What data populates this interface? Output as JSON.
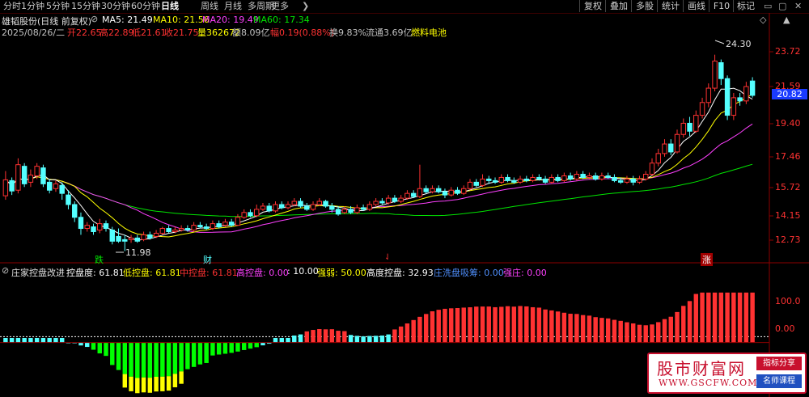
{
  "toolbar": {
    "periods": [
      "分时",
      "1分钟",
      "5分钟",
      "15分钟",
      "30分钟",
      "60分钟",
      "日线",
      "周线",
      "月线",
      "多周期",
      "更多"
    ],
    "active_period": "日线",
    "buttons": [
      "复权",
      "叠加",
      "多股",
      "统计",
      "画线",
      "F10",
      "标记"
    ],
    "more_arrow": "❯"
  },
  "header": {
    "stock_name": "雄韬股份(日线 前复权)",
    "ma5": "MA5: 21.49",
    "ma10": "MA10: 21.56",
    "ma20": "MA20: 19.49",
    "ma60": "MA60: 17.34",
    "date": "2025/08/26/二",
    "open": "开22.65",
    "high": "高22.89",
    "low": "低21.61",
    "close": "收21.75",
    "volume": "量362672",
    "amount": "额8.09亿",
    "change": "幅0.19(0.88%)",
    "turnover": "换9.83%",
    "float_cap": "流通3.69亿",
    "sector": "燃料电池"
  },
  "price_axis": {
    "ticks": [
      "23.72",
      "21.59",
      "19.40",
      "17.46",
      "15.72",
      "14.15",
      "12.73"
    ],
    "current": "20.82"
  },
  "price_annotations": {
    "high_label": "24.30",
    "low_label": "11.98",
    "die_marker": "跌",
    "cai_marker": "财",
    "zhang_marker": "涨"
  },
  "indicator": {
    "name": "庄家控盘改进",
    "kongpandu": "控盘度: 61.81",
    "dikongpan": "低控盘: 61.81",
    "zhongkongpan": "中控盘: 61.81",
    "gaokongpan": "高控盘: 0.00",
    "ten": ": 10.00",
    "qiangruo": "强弱: 50.00",
    "gaodukongpan": "高度控盘: 32.93",
    "xichou": "庄洗盘吸筹: 0.00",
    "qiangzhuang": "强庄: 0.00",
    "axis_ticks": [
      "100.0",
      "0.00"
    ]
  },
  "watermark": {
    "title": "股市财富网",
    "url": "WWW.GSCFW.COM",
    "tag1": "指标分享",
    "tag2": "名师课程"
  },
  "colors": {
    "up": "#ff3232",
    "down": "#54ffff",
    "ma5": "#ffffff",
    "ma10": "#ffff00",
    "ma20": "#ff40ff",
    "ma60": "#00e600"
  },
  "chart_data": {
    "type": "candlestick",
    "price_ylim": [
      11.5,
      25.5
    ],
    "candles": [
      [
        15.45,
        16.45,
        17.0,
        15.2
      ],
      [
        16.4,
        15.75,
        16.6,
        15.5
      ],
      [
        15.8,
        17.4,
        17.8,
        15.6
      ],
      [
        17.3,
        16.2,
        17.5,
        16.0
      ],
      [
        16.3,
        16.75,
        17.1,
        16.0
      ],
      [
        16.7,
        17.3,
        17.5,
        16.5
      ],
      [
        17.2,
        16.2,
        17.4,
        16.0
      ],
      [
        16.3,
        15.8,
        16.5,
        15.6
      ],
      [
        15.9,
        16.2,
        16.4,
        15.7
      ],
      [
        16.1,
        15.6,
        16.3,
        15.2
      ],
      [
        15.5,
        14.9,
        15.8,
        14.6
      ],
      [
        14.9,
        14.1,
        15.1,
        13.8
      ],
      [
        14.1,
        13.4,
        14.4,
        13.0
      ],
      [
        13.4,
        13.6,
        13.8,
        13.2
      ],
      [
        13.5,
        13.2,
        13.7,
        13.0
      ],
      [
        13.3,
        13.7,
        14.0,
        13.1
      ],
      [
        13.7,
        13.4,
        13.9,
        13.2
      ],
      [
        13.3,
        12.6,
        13.5,
        12.4
      ],
      [
        12.9,
        12.6,
        13.4,
        12.5
      ],
      [
        12.7,
        12.6,
        13.0,
        11.98
      ],
      [
        12.7,
        12.8,
        13.0,
        12.5
      ],
      [
        12.8,
        12.6,
        13.0,
        12.5
      ],
      [
        12.7,
        13.0,
        13.2,
        12.6
      ],
      [
        13.0,
        12.8,
        13.2,
        12.7
      ],
      [
        12.9,
        13.1,
        13.3,
        12.8
      ],
      [
        13.1,
        13.4,
        13.5,
        13.0
      ],
      [
        13.4,
        13.2,
        13.6,
        13.1
      ],
      [
        13.2,
        13.3,
        13.5,
        13.1
      ],
      [
        13.3,
        13.4,
        13.6,
        13.2
      ],
      [
        13.4,
        13.3,
        13.6,
        13.2
      ],
      [
        13.3,
        13.6,
        13.8,
        13.2
      ],
      [
        13.6,
        13.5,
        13.8,
        13.4
      ],
      [
        13.5,
        13.4,
        13.7,
        13.3
      ],
      [
        13.4,
        13.7,
        13.9,
        13.3
      ],
      [
        13.7,
        13.5,
        13.9,
        13.4
      ],
      [
        13.6,
        13.8,
        14.0,
        13.5
      ],
      [
        13.8,
        13.6,
        14.0,
        13.5
      ],
      [
        13.6,
        14.1,
        14.3,
        13.6
      ],
      [
        14.1,
        14.4,
        14.6,
        14.0
      ],
      [
        14.4,
        14.2,
        14.6,
        14.1
      ],
      [
        14.2,
        14.6,
        14.9,
        14.1
      ],
      [
        14.6,
        14.8,
        15.0,
        14.5
      ],
      [
        14.8,
        14.5,
        15.0,
        14.4
      ],
      [
        14.5,
        14.9,
        15.1,
        14.4
      ],
      [
        14.9,
        14.7,
        15.1,
        14.6
      ],
      [
        14.7,
        14.9,
        15.1,
        14.6
      ],
      [
        14.9,
        15.1,
        15.3,
        14.8
      ],
      [
        15.1,
        14.8,
        15.3,
        14.7
      ],
      [
        14.8,
        14.6,
        15.0,
        14.5
      ],
      [
        14.6,
        14.9,
        15.1,
        14.5
      ],
      [
        14.9,
        15.1,
        15.3,
        14.8
      ],
      [
        15.1,
        14.8,
        15.2,
        14.7
      ],
      [
        14.8,
        14.6,
        15.0,
        14.4
      ],
      [
        14.6,
        14.3,
        14.8,
        14.2
      ],
      [
        14.4,
        14.6,
        14.8,
        14.3
      ],
      [
        14.6,
        14.4,
        14.8,
        14.3
      ],
      [
        14.4,
        14.7,
        14.9,
        14.3
      ],
      [
        14.7,
        14.6,
        14.9,
        14.5
      ],
      [
        14.6,
        14.9,
        15.1,
        14.5
      ],
      [
        14.9,
        15.1,
        15.3,
        14.8
      ],
      [
        15.1,
        15.0,
        15.3,
        14.9
      ],
      [
        15.0,
        15.3,
        15.5,
        14.9
      ],
      [
        15.3,
        15.1,
        15.5,
        15.0
      ],
      [
        15.1,
        15.3,
        15.5,
        15.0
      ],
      [
        15.3,
        15.6,
        15.8,
        15.2
      ],
      [
        15.6,
        15.4,
        15.8,
        15.3
      ],
      [
        15.4,
        15.9,
        17.4,
        15.3
      ],
      [
        15.9,
        15.7,
        16.1,
        15.6
      ],
      [
        15.7,
        15.9,
        16.1,
        15.6
      ],
      [
        15.9,
        15.7,
        16.1,
        15.6
      ],
      [
        15.7,
        15.5,
        15.9,
        15.3
      ],
      [
        15.5,
        15.8,
        16.0,
        15.4
      ],
      [
        15.8,
        15.6,
        16.0,
        15.5
      ],
      [
        15.6,
        15.9,
        16.1,
        15.5
      ],
      [
        15.9,
        16.3,
        16.5,
        15.8
      ],
      [
        16.3,
        16.1,
        16.5,
        16.0
      ],
      [
        16.1,
        16.5,
        16.8,
        16.0
      ],
      [
        16.5,
        16.4,
        16.7,
        16.2
      ],
      [
        16.4,
        16.3,
        16.6,
        16.2
      ],
      [
        16.3,
        16.6,
        16.8,
        16.2
      ],
      [
        16.6,
        16.4,
        16.8,
        16.3
      ],
      [
        16.4,
        16.3,
        16.6,
        16.2
      ],
      [
        16.3,
        16.5,
        16.7,
        16.2
      ],
      [
        16.5,
        16.4,
        16.7,
        16.3
      ],
      [
        16.4,
        16.6,
        16.8,
        16.3
      ],
      [
        16.6,
        16.5,
        16.8,
        16.4
      ],
      [
        16.5,
        16.3,
        16.7,
        16.2
      ],
      [
        16.3,
        16.6,
        16.8,
        16.2
      ],
      [
        16.6,
        16.4,
        16.8,
        16.3
      ],
      [
        16.4,
        16.7,
        16.9,
        16.3
      ],
      [
        16.7,
        16.5,
        16.9,
        16.4
      ],
      [
        16.5,
        16.8,
        17.0,
        16.4
      ],
      [
        16.8,
        16.6,
        17.0,
        16.5
      ],
      [
        16.6,
        16.7,
        16.9,
        16.5
      ],
      [
        16.7,
        16.5,
        16.9,
        16.4
      ],
      [
        16.5,
        16.7,
        16.9,
        16.4
      ],
      [
        16.7,
        16.6,
        16.9,
        16.5
      ],
      [
        16.6,
        16.4,
        16.8,
        16.3
      ],
      [
        16.4,
        16.3,
        16.6,
        16.2
      ],
      [
        16.3,
        16.5,
        16.7,
        16.2
      ],
      [
        16.5,
        16.3,
        16.7,
        16.1
      ],
      [
        16.3,
        16.5,
        16.7,
        16.2
      ],
      [
        16.5,
        16.8,
        17.0,
        16.4
      ],
      [
        16.8,
        17.5,
        17.8,
        16.7
      ],
      [
        17.5,
        18.1,
        18.4,
        17.3
      ],
      [
        18.1,
        18.7,
        19.0,
        17.9
      ],
      [
        18.7,
        18.2,
        19.0,
        18.0
      ],
      [
        18.2,
        19.3,
        19.6,
        18.1
      ],
      [
        19.3,
        20.0,
        20.3,
        19.1
      ],
      [
        20.0,
        19.5,
        20.4,
        19.2
      ],
      [
        19.5,
        20.5,
        20.8,
        19.4
      ],
      [
        20.5,
        21.3,
        21.6,
        20.3
      ],
      [
        21.3,
        22.2,
        22.5,
        21.0
      ],
      [
        22.2,
        23.9,
        24.3,
        22.0
      ],
      [
        23.8,
        22.8,
        24.0,
        22.4
      ],
      [
        22.8,
        20.5,
        23.0,
        20.2
      ],
      [
        20.5,
        21.6,
        21.9,
        20.2
      ],
      [
        21.6,
        21.4,
        21.9,
        21.1
      ],
      [
        21.4,
        22.3,
        22.6,
        21.2
      ],
      [
        22.65,
        21.75,
        22.89,
        21.61
      ]
    ],
    "indicator_ylim": [
      -120,
      140
    ]
  }
}
